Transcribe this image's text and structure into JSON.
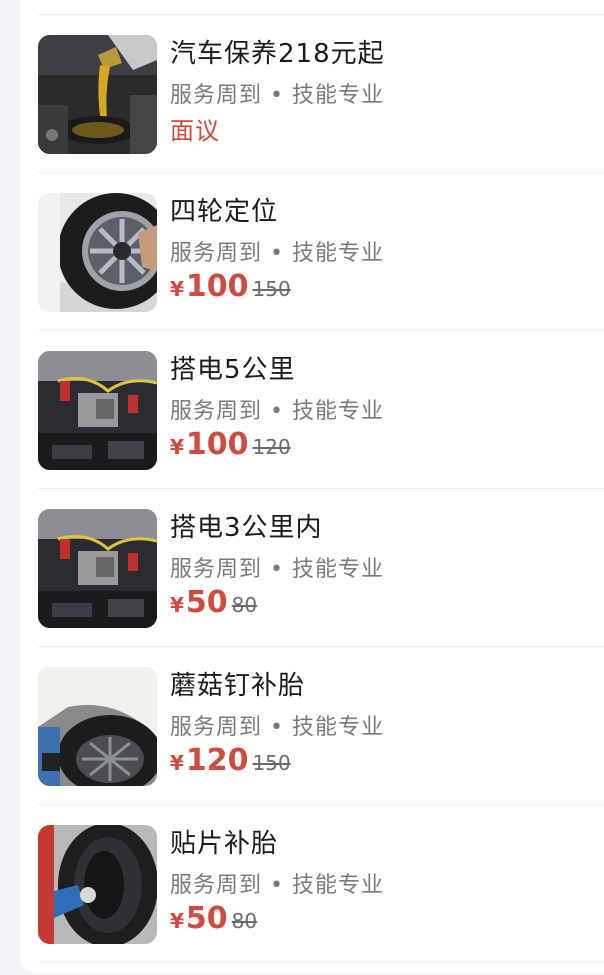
{
  "services": [
    {
      "title": "汽车保养218元起",
      "subtitle": "服务周到 • 技能专业",
      "price_text": "面议",
      "price": null,
      "original_price": null,
      "image": "oil-change-photo"
    },
    {
      "title": "四轮定位",
      "subtitle": "服务周到 • 技能专业",
      "price_text": null,
      "currency": "¥",
      "price": "100",
      "original_price": "150",
      "image": "wheel-alignment-photo"
    },
    {
      "title": "搭电5公里",
      "subtitle": "服务周到 • 技能专业",
      "price_text": null,
      "currency": "¥",
      "price": "100",
      "original_price": "120",
      "image": "jump-start-photo"
    },
    {
      "title": "搭电3公里内",
      "subtitle": "服务周到 • 技能专业",
      "price_text": null,
      "currency": "¥",
      "price": "50",
      "original_price": "80",
      "image": "jump-start-photo"
    },
    {
      "title": "蘑菇钉补胎",
      "subtitle": "服务周到 • 技能专业",
      "price_text": null,
      "currency": "¥",
      "price": "120",
      "original_price": "150",
      "image": "tire-repair-photo"
    },
    {
      "title": "贴片补胎",
      "subtitle": "服务周到 • 技能专业",
      "price_text": null,
      "currency": "¥",
      "price": "50",
      "original_price": "80",
      "image": "tire-patch-photo"
    }
  ],
  "colors": {
    "price": "#cf4a3f",
    "title": "#1b1b1b",
    "subtitle": "#7a7a7a",
    "page_background": "#f2f4f8"
  }
}
